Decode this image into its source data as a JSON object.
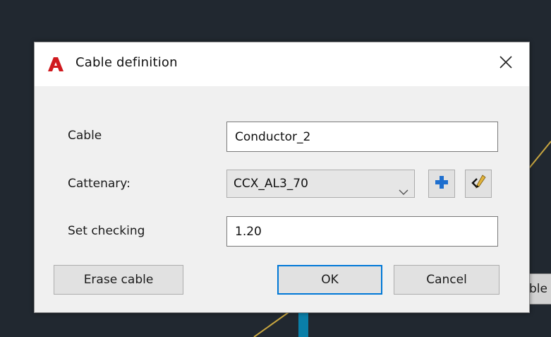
{
  "background": {
    "tooltip_text": "ble",
    "colors": {
      "canvas": "#212830",
      "line": "#c8a640",
      "pole": "#0a7fa8"
    }
  },
  "dialog": {
    "title": "Cable definition",
    "app_icon": "autocad-icon",
    "close_icon": "close-icon",
    "fields": {
      "cable": {
        "label": "Cable",
        "value": "Conductor_2"
      },
      "cattenary": {
        "label": "Cattenary:",
        "value": "CCX_AL3_70"
      },
      "set_checking": {
        "label": "Set checking",
        "value": "1.20"
      }
    },
    "icon_buttons": {
      "add": "plus-icon",
      "edit": "edit-pencil-icon"
    },
    "buttons": {
      "erase": "Erase cable",
      "ok": "OK",
      "cancel": "Cancel"
    },
    "colors": {
      "accent": "#0078d7",
      "brand": "#d0191e",
      "plus": "#1e6fcf"
    }
  }
}
